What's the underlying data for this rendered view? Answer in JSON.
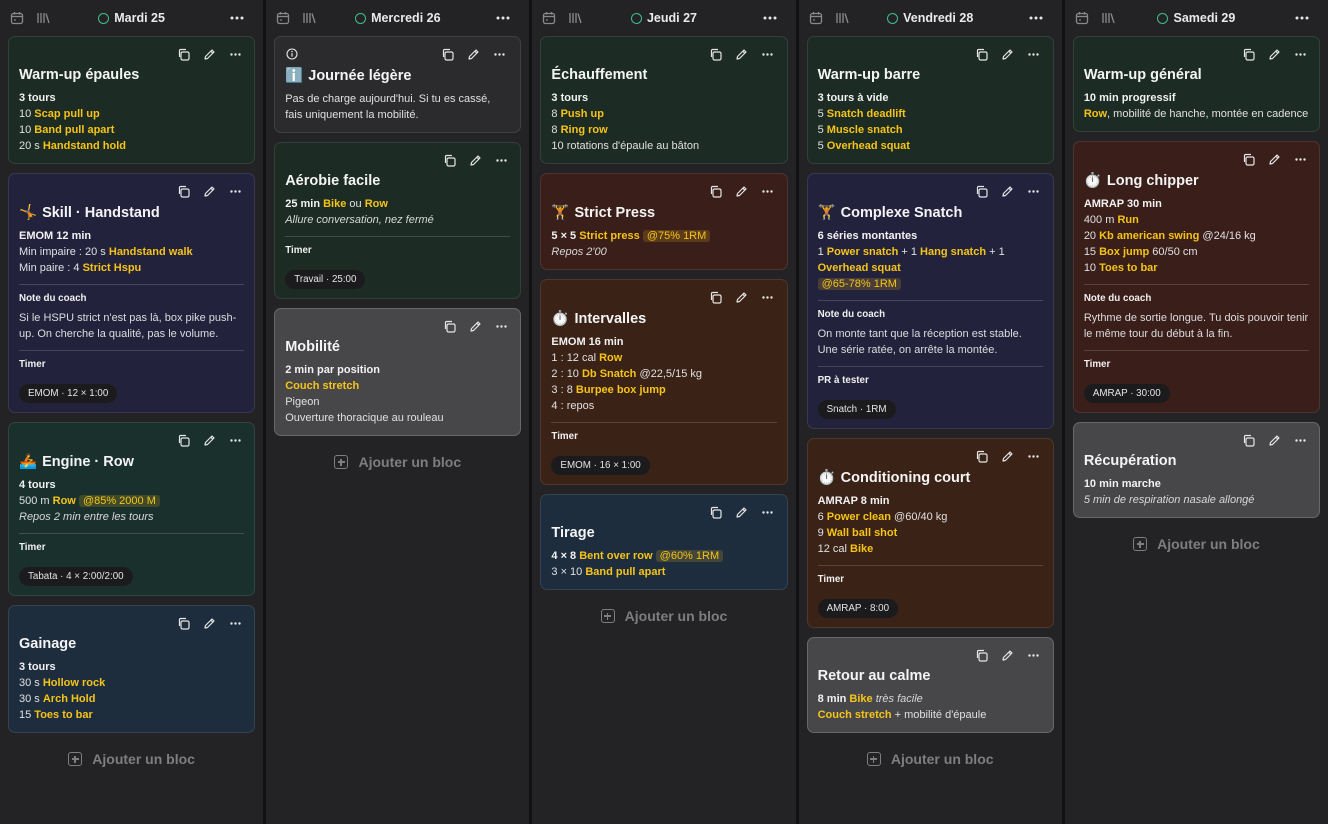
{
  "add_block_label": "Ajouter un bloc",
  "colors": {
    "accent": "#f5c419",
    "status": "#3fbf8a"
  },
  "columns": [
    {
      "day": "Mardi 25",
      "cards": [
        {
          "theme": "green",
          "title": "Warm-up épaules",
          "lines": [
            [
              {
                "t": "3 tours",
                "s": "b"
              }
            ],
            [
              {
                "t": "10 "
              },
              {
                "t": "Scap pull up",
                "s": "y"
              }
            ],
            [
              {
                "t": "10 "
              },
              {
                "t": "Band pull apart",
                "s": "y"
              }
            ],
            [
              {
                "t": "20 s "
              },
              {
                "t": "Handstand hold",
                "s": "y"
              }
            ]
          ]
        },
        {
          "theme": "purple",
          "icon": "🤸",
          "title": "Skill · Handstand",
          "lines": [
            [
              {
                "t": "EMOM 12 min",
                "s": "b"
              }
            ],
            [
              {
                "t": "Min impaire : 20 s "
              },
              {
                "t": "Handstand walk",
                "s": "y"
              }
            ],
            [
              {
                "t": "Min paire : 4 "
              },
              {
                "t": "Strict Hspu",
                "s": "y"
              }
            ]
          ],
          "note_label": "Note du coach",
          "note": "Si le HSPU strict n'est pas là, box pike push-up. On cherche la qualité, pas le volume.",
          "timer_label": "Timer",
          "timer": "EMOM · 12 × 1:00"
        },
        {
          "theme": "teal",
          "icon": "🚣",
          "title": "Engine · Row",
          "lines": [
            [
              {
                "t": "4 tours",
                "s": "b"
              }
            ],
            [
              {
                "t": "500 m "
              },
              {
                "t": "Row",
                "s": "y"
              },
              {
                "t": " "
              },
              {
                "t": "@85% 2000 M",
                "s": "chip"
              }
            ],
            [
              {
                "t": "Repos 2 min entre les tours",
                "s": "i"
              }
            ]
          ],
          "timer_label": "Timer",
          "timer": "Tabata · 4 × 2:00/2:00"
        },
        {
          "theme": "blue",
          "title": "Gainage",
          "lines": [
            [
              {
                "t": "3 tours",
                "s": "b"
              }
            ],
            [
              {
                "t": "30 s "
              },
              {
                "t": "Hollow rock",
                "s": "y"
              }
            ],
            [
              {
                "t": "30 s "
              },
              {
                "t": "Arch Hold",
                "s": "y"
              }
            ],
            [
              {
                "t": "15 "
              },
              {
                "t": "Toes to bar",
                "s": "y"
              }
            ]
          ]
        }
      ]
    },
    {
      "day": "Mercredi 26",
      "cards": [
        {
          "theme": "dark",
          "info": true,
          "icon": "ℹ️",
          "title": "Journée légère",
          "lines": [
            [
              {
                "t": "Pas de charge aujourd'hui. Si tu es cassé, fais uniquement la mobilité."
              }
            ]
          ]
        },
        {
          "theme": "green",
          "title": "Aérobie facile",
          "lines": [
            [
              {
                "t": "25 min ",
                "s": "b"
              },
              {
                "t": "Bike",
                "s": "y"
              },
              {
                "t": " ou "
              },
              {
                "t": "Row",
                "s": "y"
              }
            ],
            [
              {
                "t": "Allure conversation, nez fermé",
                "s": "i"
              }
            ]
          ],
          "timer_label": "Timer",
          "timer": "Travail · 25:00"
        },
        {
          "theme": "gray",
          "title": "Mobilité",
          "lines": [
            [
              {
                "t": "2 min par position",
                "s": "b"
              }
            ],
            [
              {
                "t": "Couch stretch",
                "s": "y"
              }
            ],
            [
              {
                "t": "Pigeon"
              }
            ],
            [
              {
                "t": "Ouverture thoracique au rouleau"
              }
            ]
          ]
        }
      ]
    },
    {
      "day": "Jeudi 27",
      "cards": [
        {
          "theme": "green",
          "title": "Échauffement",
          "lines": [
            [
              {
                "t": "3 tours",
                "s": "b"
              }
            ],
            [
              {
                "t": "8 "
              },
              {
                "t": "Push up",
                "s": "y"
              }
            ],
            [
              {
                "t": "8 "
              },
              {
                "t": "Ring row",
                "s": "y"
              }
            ],
            [
              {
                "t": "10 rotations d'épaule au bâton"
              }
            ]
          ]
        },
        {
          "theme": "red",
          "icon": "🏋️",
          "title": "Strict Press",
          "lines": [
            [
              {
                "t": "5 × 5 ",
                "s": "b"
              },
              {
                "t": "Strict press",
                "s": "y"
              },
              {
                "t": " "
              },
              {
                "t": "@75% 1RM",
                "s": "chip"
              }
            ],
            [
              {
                "t": "Repos 2'00",
                "s": "i"
              }
            ]
          ]
        },
        {
          "theme": "brown",
          "icon": "⏱️",
          "title": "Intervalles",
          "lines": [
            [
              {
                "t": "EMOM 16 min",
                "s": "b"
              }
            ],
            [
              {
                "t": "1 : 12 cal "
              },
              {
                "t": "Row",
                "s": "y"
              }
            ],
            [
              {
                "t": "2 : 10 "
              },
              {
                "t": "Db Snatch",
                "s": "y"
              },
              {
                "t": " @22,5/15 kg"
              }
            ],
            [
              {
                "t": "3 : 8 "
              },
              {
                "t": "Burpee box jump",
                "s": "y"
              }
            ],
            [
              {
                "t": "4 : repos"
              }
            ]
          ],
          "timer_label": "Timer",
          "timer": "EMOM · 16 × 1:00"
        },
        {
          "theme": "blue",
          "title": "Tirage",
          "lines": [
            [
              {
                "t": "4 × 8 ",
                "s": "b"
              },
              {
                "t": "Bent over row",
                "s": "y"
              },
              {
                "t": " "
              },
              {
                "t": "@60% 1RM",
                "s": "chip"
              }
            ],
            [
              {
                "t": "3 × 10 "
              },
              {
                "t": "Band pull apart",
                "s": "y"
              }
            ]
          ]
        }
      ]
    },
    {
      "day": "Vendredi 28",
      "cards": [
        {
          "theme": "green",
          "title": "Warm-up barre",
          "lines": [
            [
              {
                "t": "3 tours à vide",
                "s": "b"
              }
            ],
            [
              {
                "t": "5 "
              },
              {
                "t": "Snatch deadlift",
                "s": "y"
              }
            ],
            [
              {
                "t": "5 "
              },
              {
                "t": "Muscle snatch",
                "s": "y"
              }
            ],
            [
              {
                "t": "5 "
              },
              {
                "t": "Overhead squat",
                "s": "y"
              }
            ]
          ]
        },
        {
          "theme": "purple",
          "icon": "🏋️",
          "title": "Complexe Snatch",
          "lines": [
            [
              {
                "t": "6 séries montantes",
                "s": "b"
              }
            ],
            [
              {
                "t": "1 "
              },
              {
                "t": "Power snatch",
                "s": "y"
              },
              {
                "t": " + 1 "
              },
              {
                "t": "Hang snatch",
                "s": "y"
              },
              {
                "t": " + 1 "
              },
              {
                "t": "Overhead squat",
                "s": "y"
              }
            ],
            [
              {
                "t": "@65-78% 1RM",
                "s": "chip"
              }
            ]
          ],
          "note_label": "Note du coach",
          "note": "On monte tant que la réception est stable. Une série ratée, on arrête la montée.",
          "timer_label": "PR à tester",
          "timer": "Snatch · 1RM"
        },
        {
          "theme": "brown",
          "icon": "⏱️",
          "title": "Conditioning court",
          "lines": [
            [
              {
                "t": "AMRAP 8 min",
                "s": "b"
              }
            ],
            [
              {
                "t": "6 "
              },
              {
                "t": "Power clean",
                "s": "y"
              },
              {
                "t": " @60/40 kg"
              }
            ],
            [
              {
                "t": "9 "
              },
              {
                "t": "Wall ball shot",
                "s": "y"
              }
            ],
            [
              {
                "t": "12 cal "
              },
              {
                "t": "Bike",
                "s": "y"
              }
            ]
          ],
          "timer_label": "Timer",
          "timer": "AMRAP · 8:00"
        },
        {
          "theme": "gray",
          "title": "Retour au calme",
          "lines": [
            [
              {
                "t": "8 min ",
                "s": "b"
              },
              {
                "t": "Bike",
                "s": "y"
              },
              {
                "t": " très facile",
                "s": "i"
              }
            ],
            [
              {
                "t": "Couch stretch",
                "s": "y"
              },
              {
                "t": " + mobilité d'épaule"
              }
            ]
          ]
        }
      ]
    },
    {
      "day": "Samedi 29",
      "cards": [
        {
          "theme": "green",
          "title": "Warm-up général",
          "lines": [
            [
              {
                "t": "10 min progressif",
                "s": "b"
              }
            ],
            [
              {
                "t": "Row",
                "s": "y"
              },
              {
                "t": ", mobilité de hanche, montée en cadence"
              }
            ]
          ]
        },
        {
          "theme": "red",
          "icon": "⏱️",
          "title": "Long chipper",
          "lines": [
            [
              {
                "t": "AMRAP 30 min",
                "s": "b"
              }
            ],
            [
              {
                "t": "400 m "
              },
              {
                "t": "Run",
                "s": "y"
              }
            ],
            [
              {
                "t": "20 "
              },
              {
                "t": "Kb american swing",
                "s": "y"
              },
              {
                "t": " @24/16 kg"
              }
            ],
            [
              {
                "t": "15 "
              },
              {
                "t": "Box jump",
                "s": "y"
              },
              {
                "t": " 60/50 cm"
              }
            ],
            [
              {
                "t": "10 "
              },
              {
                "t": "Toes to bar",
                "s": "y"
              }
            ]
          ],
          "note_label": "Note du coach",
          "note": "Rythme de sortie longue. Tu dois pouvoir tenir le même tour du début à la fin.",
          "timer_label": "Timer",
          "timer": "AMRAP · 30:00"
        },
        {
          "theme": "gray",
          "title": "Récupération",
          "lines": [
            [
              {
                "t": "10 min marche",
                "s": "b"
              }
            ],
            [
              {
                "t": "5 min de respiration nasale allongé",
                "s": "i"
              }
            ]
          ]
        }
      ]
    }
  ]
}
